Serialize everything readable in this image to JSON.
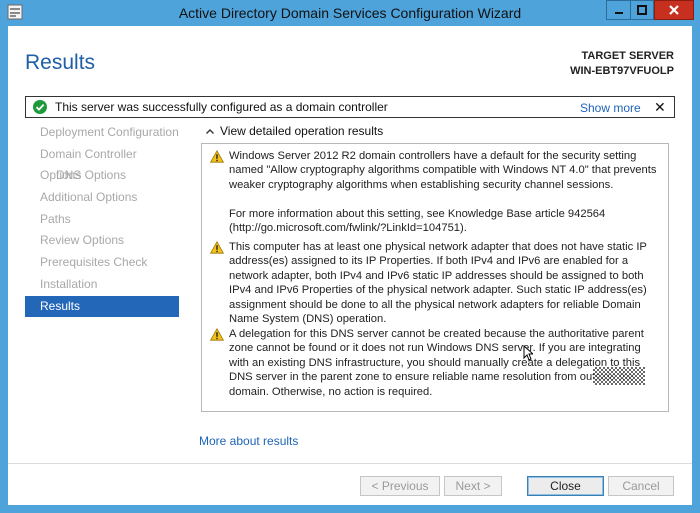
{
  "window": {
    "title": "Active Directory Domain Services Configuration Wizard"
  },
  "header": {
    "heading": "Results",
    "target_label": "TARGET SERVER",
    "target_name": "WIN-EBT97VFUOLP"
  },
  "banner": {
    "message": "This server was successfully configured as a domain controller",
    "show_more": "Show more",
    "dismiss": "✕"
  },
  "nav": {
    "items": [
      {
        "label": "Deployment Configuration"
      },
      {
        "label": "Domain Controller Options"
      },
      {
        "label": "DNS Options"
      },
      {
        "label": "Additional Options"
      },
      {
        "label": "Paths"
      },
      {
        "label": "Review Options"
      },
      {
        "label": "Prerequisites Check"
      },
      {
        "label": "Installation"
      },
      {
        "label": "Results"
      }
    ]
  },
  "details": {
    "toggle_label": "View detailed operation results",
    "entries": [
      {
        "p1": "Windows Server 2012 R2 domain controllers have a default for the security setting named \"Allow cryptography algorithms compatible with Windows NT 4.0\" that prevents weaker cryptography algorithms when establishing security channel sessions.",
        "p2": "For more information about this setting, see Knowledge Base article 942564 (http://go.microsoft.com/fwlink/?LinkId=104751)."
      },
      {
        "p1": "This computer has at least one physical network adapter that does not have static IP address(es) assigned to its IP Properties. If both IPv4 and IPv6 are enabled for a network adapter, both IPv4 and IPv6 static IP addresses should be assigned to both IPv4 and IPv6 Properties of the physical network adapter. Such static IP address(es) assignment should be done to all the physical network adapters for reliable Domain Name System (DNS) operation."
      },
      {
        "p1": "A delegation for this DNS server cannot be created because the authoritative parent zone cannot be found or it does not run Windows DNS server. If you are integrating with an existing DNS infrastructure, you should manually create a delegation to this DNS server in the parent zone to ensure reliable name resolution from outside the domain. Otherwise, no action is required."
      }
    ],
    "more_link": "More about results"
  },
  "buttons": {
    "previous": "< Previous",
    "next": "Next >",
    "close": "Close",
    "cancel": "Cancel"
  },
  "colors": {
    "titlebar": "#4ea3db",
    "accent": "#2367b9",
    "link": "#1e64b8",
    "close_button": "#c7301f"
  }
}
